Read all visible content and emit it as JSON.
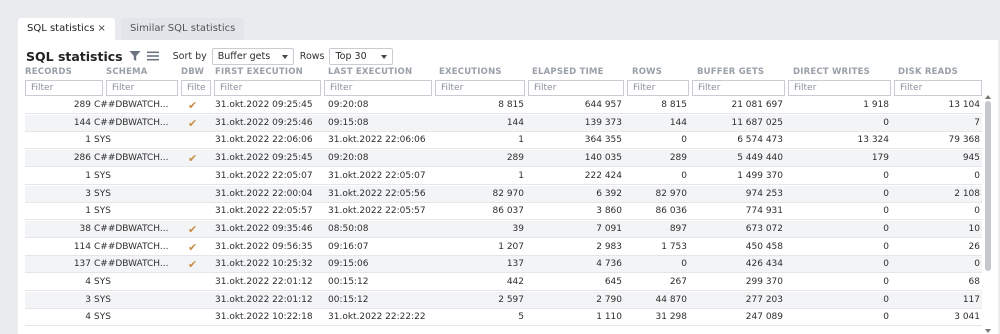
{
  "tabs": [
    {
      "label": "SQL statistics",
      "close": "×"
    },
    {
      "label": "Similar SQL statistics"
    }
  ],
  "toolbar": {
    "title": "SQL statistics",
    "sort_label": "Sort by",
    "sort_value": "Buffer gets",
    "rows_label": "Rows",
    "rows_value": "Top 30"
  },
  "columns": [
    "RECORDS",
    "SCHEMA",
    "DBW",
    "FIRST EXECUTION",
    "LAST EXECUTION",
    "EXECUTIONS",
    "ELAPSED TIME",
    "ROWS",
    "BUFFER GETS",
    "DIRECT WRITES",
    "DISK READS"
  ],
  "filter_placeholder": "Filter",
  "filter_placeholder_short": "Filte",
  "check_glyph": "✔",
  "rows": [
    {
      "records": "289",
      "schema": "C##DBWATCH...",
      "dbw": true,
      "first": "31.okt.2022 09:25:45",
      "last": "09:20:08",
      "executions": "8 815",
      "elapsed": "644 957",
      "rows": "8 815",
      "buffer_gets": "21 081 697",
      "direct_writes": "1 918",
      "disk_reads": "13 104"
    },
    {
      "records": "144",
      "schema": "C##DBWATCH...",
      "dbw": true,
      "first": "31.okt.2022 09:25:46",
      "last": "09:15:08",
      "executions": "144",
      "elapsed": "139 373",
      "rows": "144",
      "buffer_gets": "11 687 025",
      "direct_writes": "0",
      "disk_reads": "7"
    },
    {
      "records": "1",
      "schema": "SYS",
      "dbw": false,
      "first": "31.okt.2022 22:06:06",
      "last": "31.okt.2022 22:06:06",
      "executions": "1",
      "elapsed": "364 355",
      "rows": "0",
      "buffer_gets": "6 574 473",
      "direct_writes": "13 324",
      "disk_reads": "79 368"
    },
    {
      "records": "286",
      "schema": "C##DBWATCH...",
      "dbw": true,
      "first": "31.okt.2022 09:25:45",
      "last": "09:20:08",
      "executions": "289",
      "elapsed": "140 035",
      "rows": "289",
      "buffer_gets": "5 449 440",
      "direct_writes": "179",
      "disk_reads": "945"
    },
    {
      "records": "1",
      "schema": "SYS",
      "dbw": false,
      "first": "31.okt.2022 22:05:07",
      "last": "31.okt.2022 22:05:07",
      "executions": "1",
      "elapsed": "222 424",
      "rows": "0",
      "buffer_gets": "1 499 370",
      "direct_writes": "0",
      "disk_reads": "0"
    },
    {
      "records": "3",
      "schema": "SYS",
      "dbw": false,
      "first": "31.okt.2022 22:00:04",
      "last": "31.okt.2022 22:05:56",
      "executions": "82 970",
      "elapsed": "6 392",
      "rows": "82 970",
      "buffer_gets": "974 253",
      "direct_writes": "0",
      "disk_reads": "2 108"
    },
    {
      "records": "1",
      "schema": "SYS",
      "dbw": false,
      "first": "31.okt.2022 22:05:57",
      "last": "31.okt.2022 22:05:57",
      "executions": "86 037",
      "elapsed": "3 860",
      "rows": "86 036",
      "buffer_gets": "774 931",
      "direct_writes": "0",
      "disk_reads": "0"
    },
    {
      "records": "38",
      "schema": "C##DBWATCH...",
      "dbw": true,
      "first": "31.okt.2022 09:35:46",
      "last": "08:50:08",
      "executions": "39",
      "elapsed": "7 091",
      "rows": "897",
      "buffer_gets": "673 072",
      "direct_writes": "0",
      "disk_reads": "10"
    },
    {
      "records": "114",
      "schema": "C##DBWATCH...",
      "dbw": true,
      "first": "31.okt.2022 09:56:35",
      "last": "09:16:07",
      "executions": "1 207",
      "elapsed": "2 983",
      "rows": "1 753",
      "buffer_gets": "450 458",
      "direct_writes": "0",
      "disk_reads": "26"
    },
    {
      "records": "137",
      "schema": "C##DBWATCH...",
      "dbw": true,
      "first": "31.okt.2022 10:25:32",
      "last": "09:15:06",
      "executions": "137",
      "elapsed": "4 736",
      "rows": "0",
      "buffer_gets": "426 434",
      "direct_writes": "0",
      "disk_reads": "0"
    },
    {
      "records": "4",
      "schema": "SYS",
      "dbw": false,
      "first": "31.okt.2022 22:01:12",
      "last": "00:15:12",
      "executions": "442",
      "elapsed": "645",
      "rows": "267",
      "buffer_gets": "299 370",
      "direct_writes": "0",
      "disk_reads": "68"
    },
    {
      "records": "3",
      "schema": "SYS",
      "dbw": false,
      "first": "31.okt.2022 22:01:12",
      "last": "00:15:12",
      "executions": "2 597",
      "elapsed": "2 790",
      "rows": "44 870",
      "buffer_gets": "277 203",
      "direct_writes": "0",
      "disk_reads": "117"
    },
    {
      "records": "4",
      "schema": "SYS",
      "dbw": false,
      "first": "31.okt.2022 10:22:18",
      "last": "31.okt.2022 22:22:22",
      "executions": "5",
      "elapsed": "1 110",
      "rows": "31 298",
      "buffer_gets": "247 089",
      "direct_writes": "0",
      "disk_reads": "3 041"
    }
  ],
  "colors": {
    "accent_check": "#c98f4a",
    "header_text": "#9aa0a8",
    "background": "#e9ebef"
  }
}
